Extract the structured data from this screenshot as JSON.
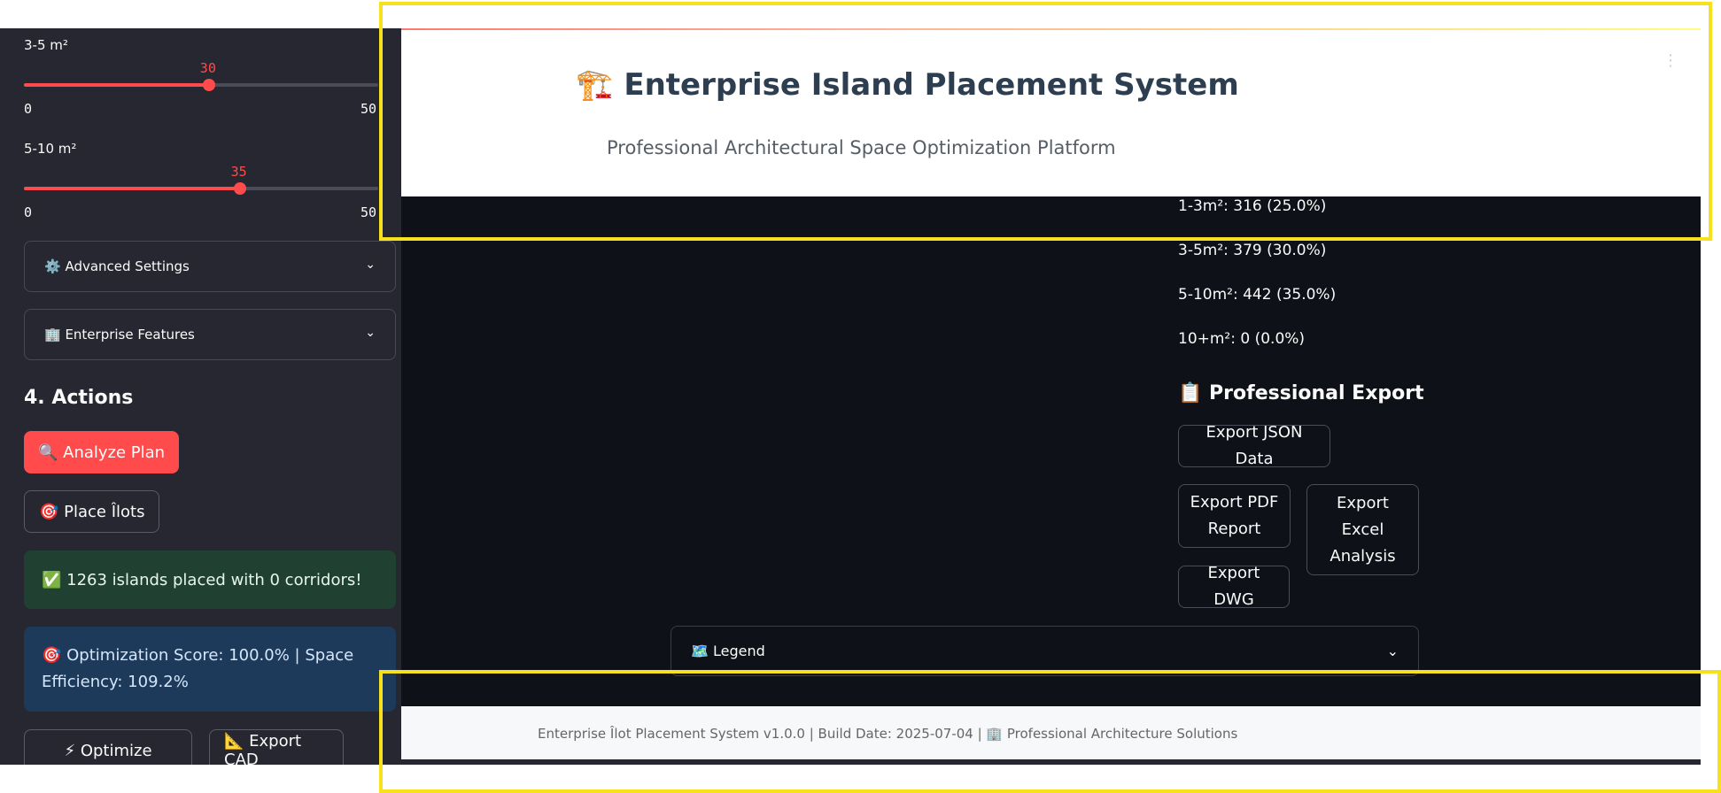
{
  "sidebar": {
    "slider_3_5": {
      "label": "3-5 m²",
      "value": "30",
      "min": "0",
      "max": "50",
      "fraction": 0.6
    },
    "slider_5_10": {
      "label": "5-10 m²",
      "value": "35",
      "min": "0",
      "max": "50",
      "fraction": 0.7
    },
    "expanders": [
      {
        "label": "⚙️ Advanced Settings"
      },
      {
        "label": "🏢 Enterprise Features"
      }
    ],
    "actions_header": "4. Actions",
    "analyze_label": "🔍 Analyze Plan",
    "place_label": "🎯 Place Îlots",
    "success_text": "✅ 1263 islands placed with 0 corridors!",
    "info_text": "🎯 Optimization Score: 100.0% | Space Efficiency: 109.2%",
    "optimize_label": "⚡ Optimize",
    "export_cad_label": "📐 Export CAD"
  },
  "header": {
    "icon": "🏗️",
    "title": "Enterprise Island Placement System",
    "subtitle": "Professional Architectural Space Optimization Platform"
  },
  "distribution": [
    "1-3m²: 316 (25.0%)",
    "3-5m²: 379 (30.0%)",
    "5-10m²: 442 (35.0%)",
    "10+m²: 0 (0.0%)"
  ],
  "export": {
    "header": "📋 Professional Export",
    "json_label": "Export JSON Data",
    "pdf_label": "Export PDF Report",
    "excel_label": "Export Excel Analysis",
    "dwg_label": "Export DWG"
  },
  "legend": {
    "label": "🗺️ Legend"
  },
  "footer": {
    "text": "Enterprise Îlot Placement System v1.0.0 | Build Date: 2025-07-04 | 🏢 Professional Architecture Solutions"
  },
  "icons": {
    "chevron": "chevron-down-icon",
    "menu": "more-vertical-icon"
  },
  "colors": {
    "accent": "#ff4b4b",
    "sidebar_bg": "#262730",
    "main_bg": "#0e1117",
    "highlight": "#f7e11e"
  }
}
